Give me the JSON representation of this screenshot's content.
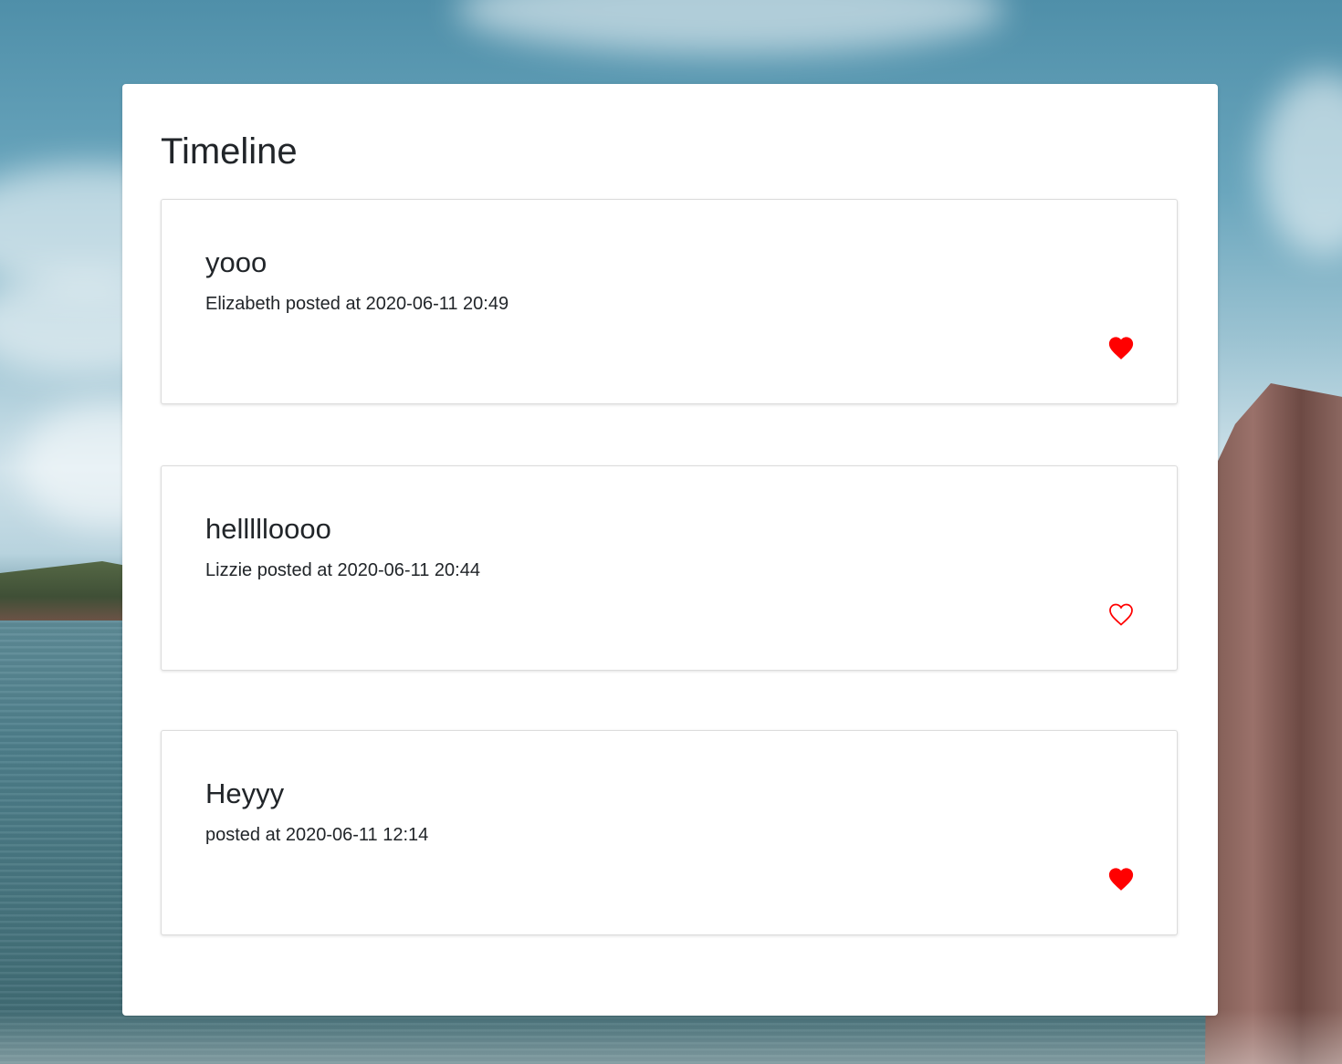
{
  "page": {
    "title": "Timeline"
  },
  "posts": [
    {
      "title": "yooo",
      "meta": "Elizabeth posted at 2020-06-11 20:49",
      "liked": true
    },
    {
      "title": "hellllloooo",
      "meta": "Lizzie posted at 2020-06-11 20:44",
      "liked": false
    },
    {
      "title": "Heyyy",
      "meta": "posted at 2020-06-11 12:14",
      "liked": true
    }
  ],
  "icons": {
    "like_filled": "heart-filled-icon",
    "like_outline": "heart-outline-icon"
  },
  "colors": {
    "heart": "#ff0000",
    "text": "#212529",
    "panel": "#ffffff"
  }
}
